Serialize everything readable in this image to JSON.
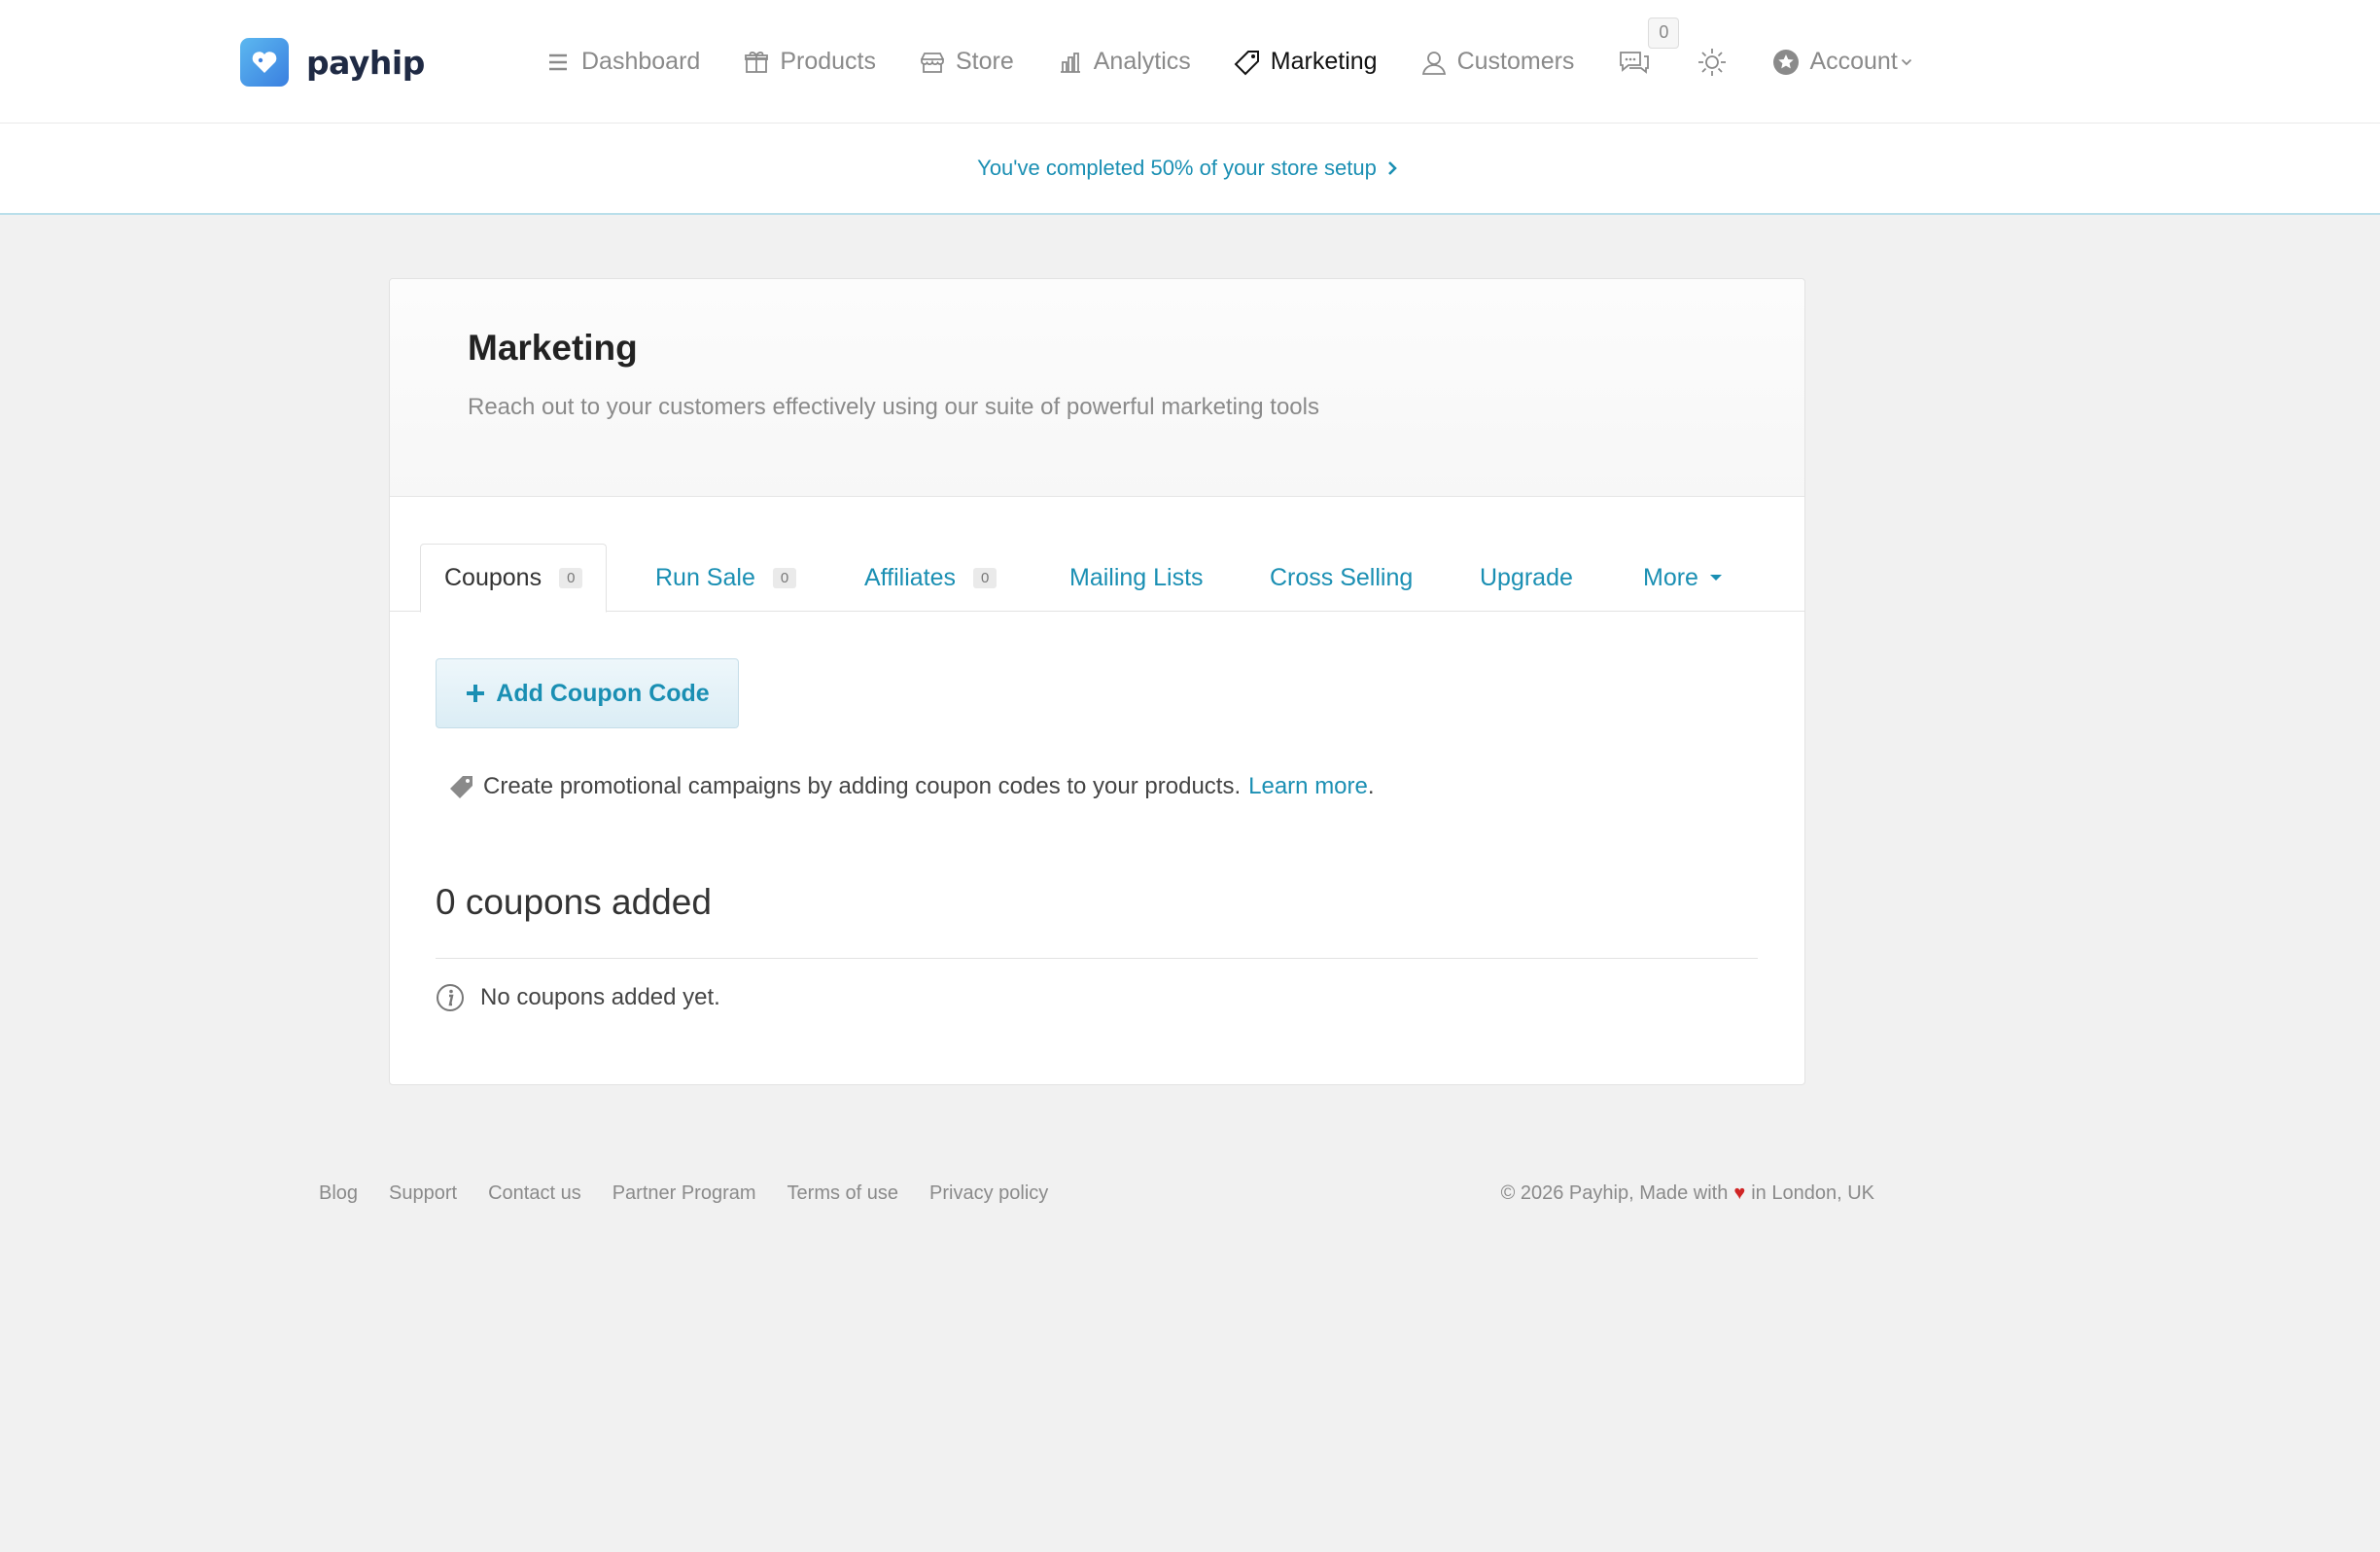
{
  "brand": {
    "name": "payhip"
  },
  "nav": {
    "items": [
      {
        "label": "Dashboard",
        "icon": "menu-lines-icon"
      },
      {
        "label": "Products",
        "icon": "gift-icon"
      },
      {
        "label": "Store",
        "icon": "storefront-icon"
      },
      {
        "label": "Analytics",
        "icon": "bar-chart-icon"
      },
      {
        "label": "Marketing",
        "icon": "tag-icon",
        "active": true
      },
      {
        "label": "Customers",
        "icon": "user-icon"
      }
    ],
    "messages_count": "0",
    "account_label": "Account"
  },
  "setup": {
    "text": "You've completed 50% of your store setup"
  },
  "marketing": {
    "title": "Marketing",
    "subtitle": "Reach out to your customers effectively using our suite of powerful marketing tools"
  },
  "tabs": [
    {
      "label": "Coupons",
      "count": "0",
      "active": true
    },
    {
      "label": "Run Sale",
      "count": "0"
    },
    {
      "label": "Affiliates",
      "count": "0"
    },
    {
      "label": "Mailing Lists"
    },
    {
      "label": "Cross Selling"
    },
    {
      "label": "Upgrade"
    },
    {
      "label": "More"
    }
  ],
  "coupons": {
    "add_button": "Add Coupon Code",
    "info_text": "Create promotional campaigns by adding coupon codes to your products.",
    "learn_more": "Learn more",
    "period": ".",
    "count_heading": "0 coupons added",
    "empty_text": "No coupons added yet."
  },
  "footer": {
    "links": [
      "Blog",
      "Support",
      "Contact us",
      "Partner Program",
      "Terms of use",
      "Privacy policy"
    ],
    "copyright_prefix": "© 2026 Payhip, Made with",
    "heart": "♥",
    "copyright_suffix": "in London, UK"
  },
  "colors": {
    "accent": "#1a8fb3",
    "background": "#f1f1f1",
    "heart": "#d02525"
  }
}
